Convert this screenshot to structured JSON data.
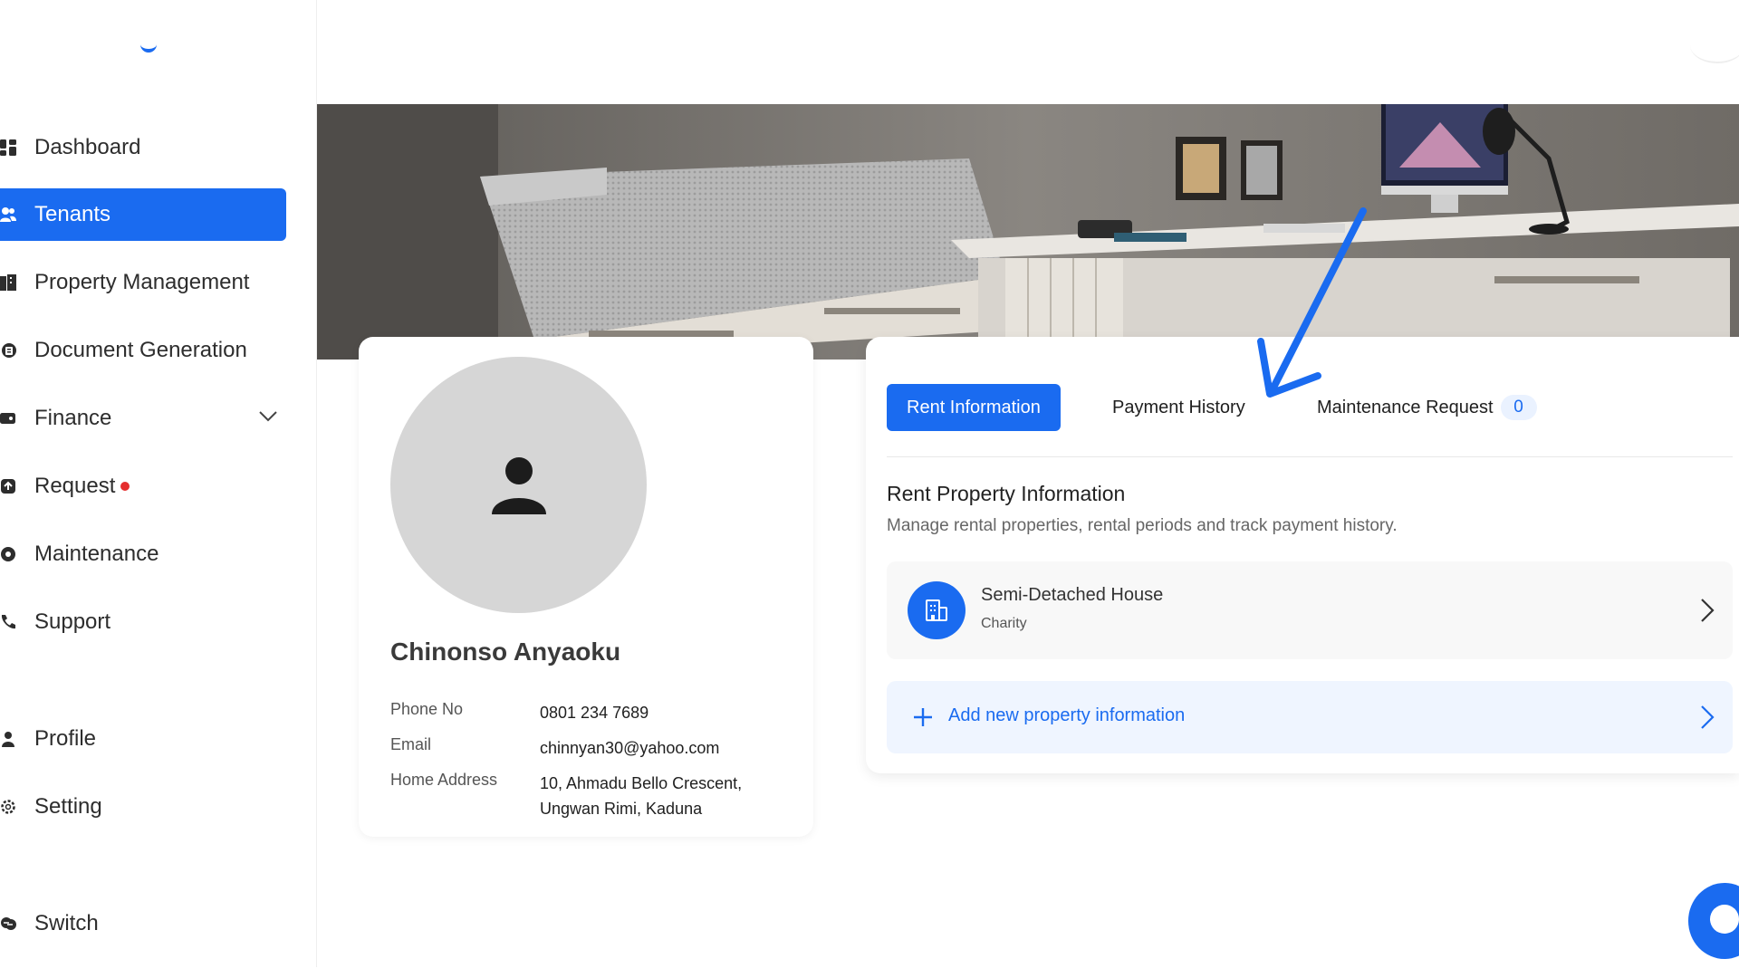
{
  "sidebar": {
    "items": [
      {
        "label": "Dashboard",
        "icon": "dashboard-icon"
      },
      {
        "label": "Tenants",
        "icon": "users-icon",
        "active": true
      },
      {
        "label": "Property Management",
        "icon": "building-icon"
      },
      {
        "label": "Document Generation",
        "icon": "document-icon"
      },
      {
        "label": "Finance",
        "icon": "wallet-icon",
        "has_dropdown": true
      },
      {
        "label": "Request",
        "icon": "request-icon",
        "notification": true
      },
      {
        "label": "Maintenance",
        "icon": "wrench-icon"
      },
      {
        "label": "Support",
        "icon": "phone-icon"
      },
      {
        "label": "Profile",
        "icon": "user-icon"
      },
      {
        "label": "Setting",
        "icon": "gear-icon"
      },
      {
        "label": "Switch",
        "icon": "switch-icon"
      }
    ]
  },
  "tenant": {
    "name": "Chinonso Anyaoku",
    "phone_label": "Phone No",
    "phone": "0801 234 7689",
    "email_label": "Email",
    "email": "chinnyan30@yahoo.com",
    "address_label": "Home Address",
    "address": "10, Ahmadu Bello Crescent, Ungwan Rimi, Kaduna"
  },
  "tabs": [
    {
      "label": "Rent Information",
      "active": true
    },
    {
      "label": "Payment History"
    },
    {
      "label": "Maintenance Request",
      "count": "0"
    }
  ],
  "rent_section": {
    "title": "Rent Property Information",
    "subtitle": "Manage rental properties, rental periods and track payment history.",
    "property": {
      "name": "Semi-Detached House",
      "type": "Charity"
    },
    "add_label": "Add new property information"
  },
  "colors": {
    "accent": "#1a6bf0",
    "notification": "#e52d2d",
    "avatar_bg": "#d6d6d6"
  }
}
